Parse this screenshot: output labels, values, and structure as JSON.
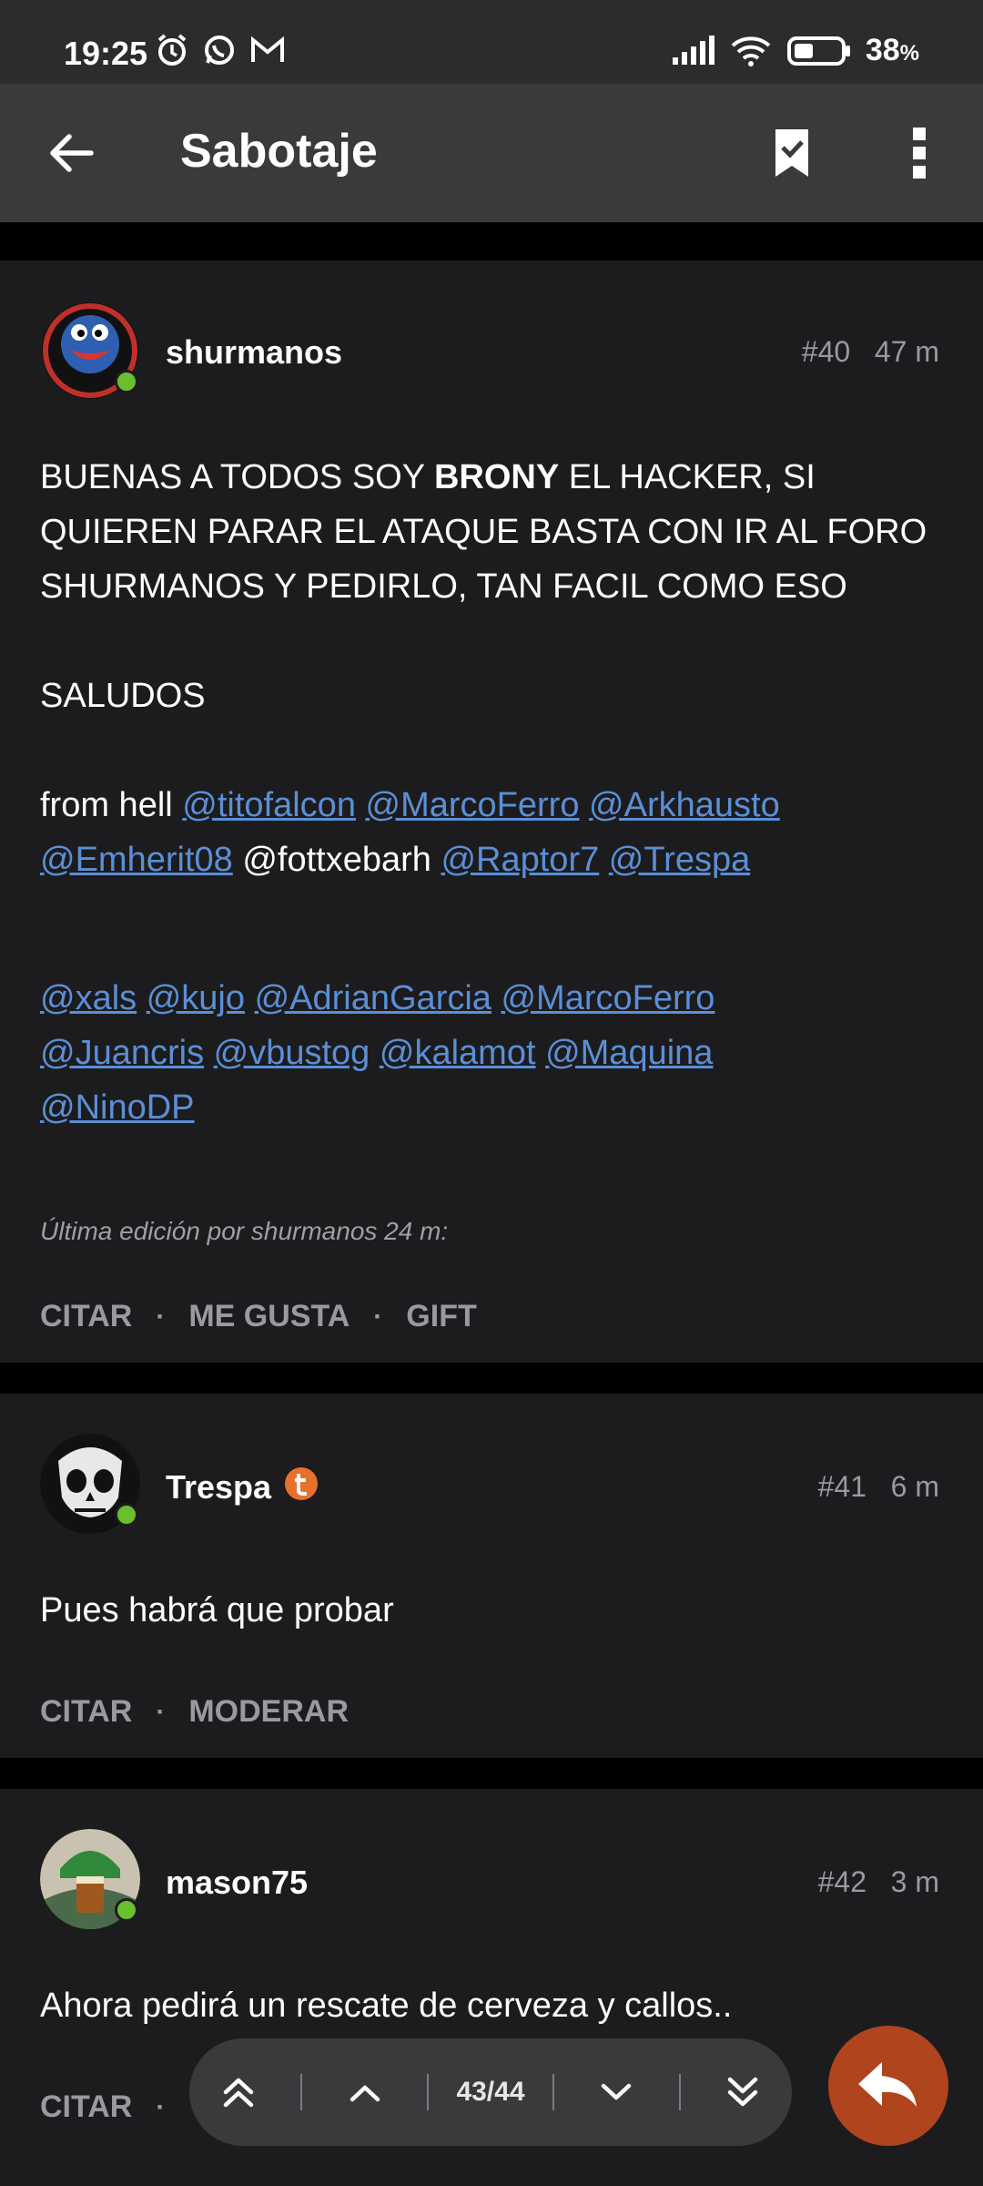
{
  "status": {
    "time": "19:25",
    "battery": "38"
  },
  "appbar": {
    "title": "Sabotaje"
  },
  "posts": [
    {
      "username": "shurmanos",
      "number": "#40",
      "time": "47 m",
      "text1_a": "BUENAS A TODOS SOY ",
      "text1_b": "BRONY",
      "text1_c": " EL HACKER, SI QUIEREN PARAR EL ATAQUE BASTA CON IR AL FORO SHURMANOS Y PEDIRLO, TAN FACIL COMO ESO",
      "text2": "SALUDOS",
      "text3_prefix": "from hell ",
      "mentions_line1": [
        "@titofalcon",
        "@MarcoFerro",
        "@Arkhausto"
      ],
      "mentions_line2a": "@Emherit08",
      "plain_mention": "@fottxebarh",
      "mentions_line2b": [
        "@Raptor7",
        "@Trespa"
      ],
      "mentions_block2": [
        "@xals",
        "@kujo",
        "@AdrianGarcia",
        "@MarcoFerro",
        "@Juancris",
        "@vbustog",
        "@kalamot",
        "@Maquina",
        "@NinoDP"
      ],
      "edit_note": "Última edición por shurmanos 24 m:",
      "actions": [
        "CITAR",
        "ME GUSTA",
        "GIFT"
      ]
    },
    {
      "username": "Trespa",
      "number": "#41",
      "time": "6 m",
      "text": "Pues habrá que probar",
      "actions": [
        "CITAR",
        "MODERAR"
      ]
    },
    {
      "username": "mason75",
      "number": "#42",
      "time": "3 m",
      "text": "Ahora pedirá un rescate de cerveza y callos..",
      "actions": [
        "CITAR"
      ]
    }
  ],
  "navigation": {
    "position": "43/44"
  },
  "separator": "·",
  "colors": {
    "accent": "#b0441c",
    "mention": "#5b8fd6",
    "online": "#6abf2e"
  }
}
